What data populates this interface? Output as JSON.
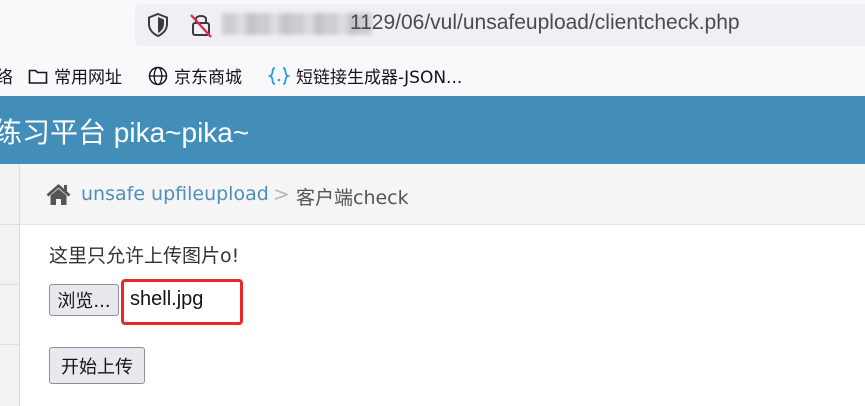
{
  "browser": {
    "url_visible": "1129/06/vul/unsafeupload/clientcheck.php",
    "bookmarks": [
      {
        "label": "络",
        "icon": "none"
      },
      {
        "label": "常用网址",
        "icon": "folder-icon"
      },
      {
        "label": "京东商城",
        "icon": "globe-icon"
      },
      {
        "label": "短链接生成器-JSON...",
        "icon": "braces-icon"
      }
    ]
  },
  "site": {
    "title": "练习平台 pika~pika~",
    "header_color": "#438eb9"
  },
  "breadcrumb": {
    "parent": "unsafe upfileupload",
    "separator": ">",
    "current": "客户端check"
  },
  "form": {
    "hint": "这里只允许上传图片o!",
    "browse_label": "浏览...",
    "selected_file": "shell.jpg",
    "submit_label": "开始上传",
    "highlight_color": "#e8292b"
  }
}
